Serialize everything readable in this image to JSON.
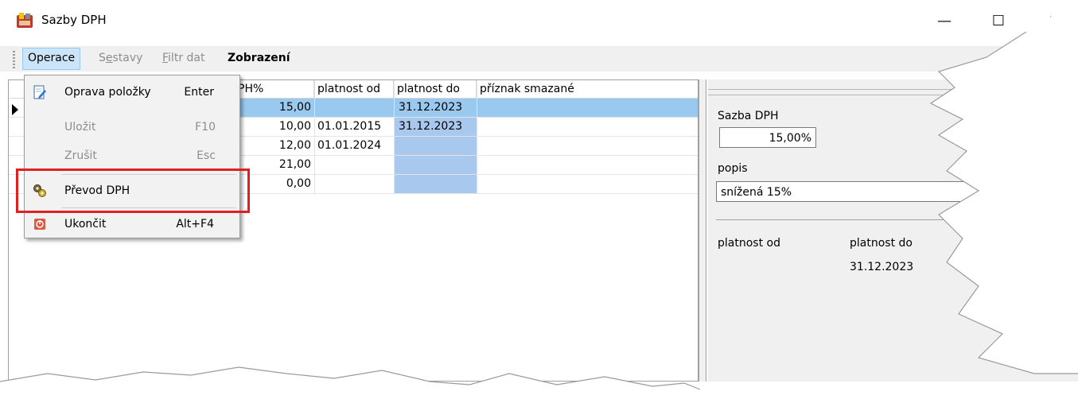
{
  "window": {
    "title": "Sazby DPH",
    "controls": {
      "minimize": "—",
      "maximize": "☐",
      "close": "✕"
    }
  },
  "menubar": {
    "operace": "Operace",
    "sestavy_u": "e",
    "sestavy_a": "S",
    "sestavy_b": "stavy",
    "filtr_u": "F",
    "filtr_b": "iltr dat",
    "zobrazeni": "Zobrazení"
  },
  "grid": {
    "headers": [
      "PH%",
      "platnost od",
      "platnost do",
      "příznak smazané"
    ],
    "rows": [
      {
        "dph": "15,00",
        "od": "",
        "do": "31.12.2023",
        "smazane": ""
      },
      {
        "dph": "10,00",
        "od": "01.01.2015",
        "do": "31.12.2023",
        "smazane": ""
      },
      {
        "dph": "12,00",
        "od": "01.01.2024",
        "do": "",
        "smazane": ""
      },
      {
        "dph": "21,00",
        "od": "",
        "do": "",
        "smazane": ""
      },
      {
        "dph": "0,00",
        "od": "",
        "do": "",
        "smazane": ""
      }
    ]
  },
  "operace_menu": {
    "items": [
      {
        "label": "Oprava položky",
        "shortcut": "Enter",
        "icon": "edit-document-icon",
        "enabled": true
      },
      {
        "label": "Uložit",
        "shortcut": "F10",
        "enabled": false
      },
      {
        "label": "Zrušit",
        "shortcut": "Esc",
        "enabled": false
      },
      {
        "label": "Převod DPH",
        "shortcut": "",
        "icon": "gears-icon",
        "enabled": true
      },
      {
        "label": "Ukončit",
        "shortcut": "Alt+F4",
        "icon": "exit-icon",
        "enabled": true
      }
    ]
  },
  "detail": {
    "sazba_label": "Sazba DPH",
    "sazba_value": "15,00%",
    "popis_label": "popis",
    "popis_value": "snížená 15%",
    "platnost_od_label": "platnost od",
    "platnost_do_label": "platnost do",
    "platnost_do_value": "31.12.2023"
  },
  "colors": {
    "selection": "#99c9ef",
    "menu_highlight": "#cce4f7",
    "annotation_red": "#e02020"
  }
}
